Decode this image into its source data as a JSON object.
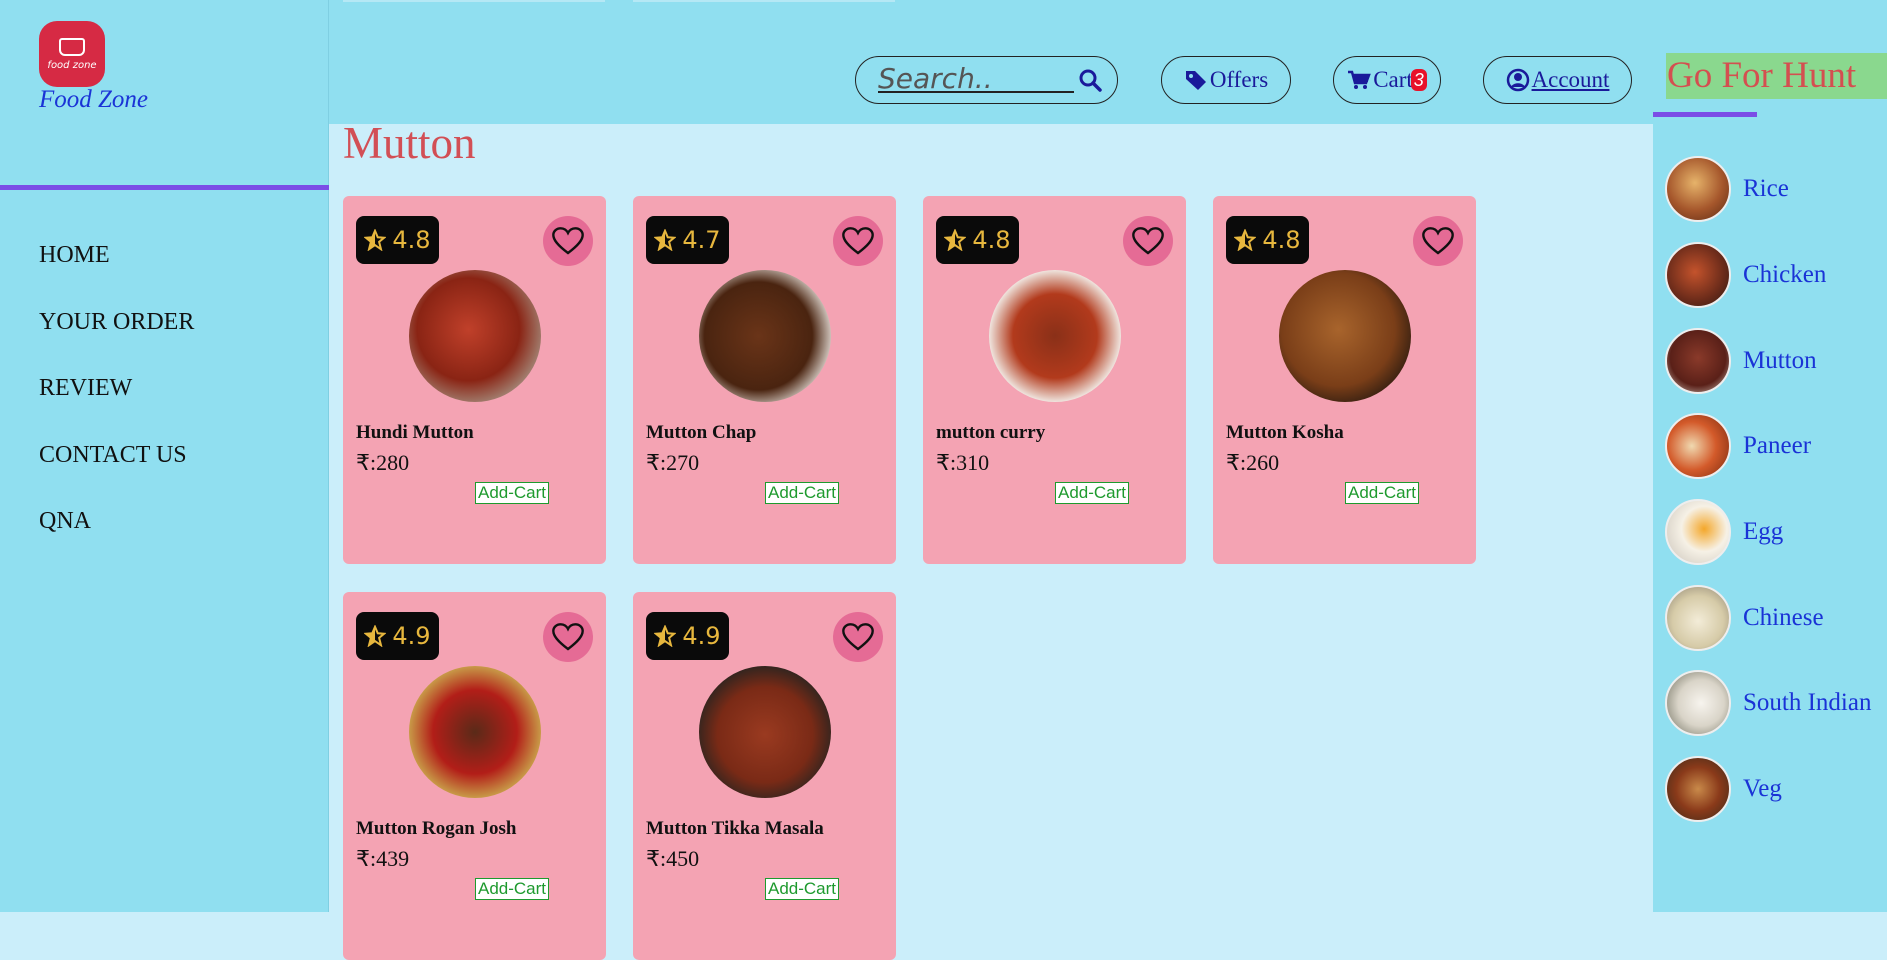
{
  "brand": {
    "logo_text": "food zone",
    "name": "Food Zone"
  },
  "nav": [
    "HOME",
    "YOUR ORDER",
    "REVIEW",
    "CONTACT US",
    "QNA"
  ],
  "header": {
    "search_placeholder": "Search..",
    "offers_label": "Offers",
    "cart_label": "Cart",
    "cart_count": "3",
    "account_label": "Account",
    "tagline": "Go For Hunt"
  },
  "page_title": "Mutton",
  "dishes": [
    {
      "rating": "4.8",
      "name": "Hundi Mutton",
      "price": "₹:280",
      "add": "Add-Cart"
    },
    {
      "rating": "4.7",
      "name": "Mutton Chap",
      "price": "₹:270",
      "add": "Add-Cart"
    },
    {
      "rating": "4.8",
      "name": "mutton curry",
      "price": "₹:310",
      "add": "Add-Cart"
    },
    {
      "rating": "4.8",
      "name": "Mutton Kosha",
      "price": "₹:260",
      "add": "Add-Cart"
    },
    {
      "rating": "4.9",
      "name": "Mutton Rogan Josh",
      "price": "₹:439",
      "add": "Add-Cart"
    },
    {
      "rating": "4.9",
      "name": "Mutton Tikka Masala",
      "price": "₹:450",
      "add": "Add-Cart"
    }
  ],
  "categories": [
    "Rice",
    "Chicken",
    "Mutton",
    "Paneer",
    "Egg",
    "Chinese",
    "South Indian",
    "Veg"
  ],
  "colors": {
    "sidebar": "#90dff0",
    "content": "#cbeefa",
    "card": "#f4a3b3",
    "accent": "#7b4de6",
    "heart": "#e56b95",
    "title": "#d24f55"
  }
}
